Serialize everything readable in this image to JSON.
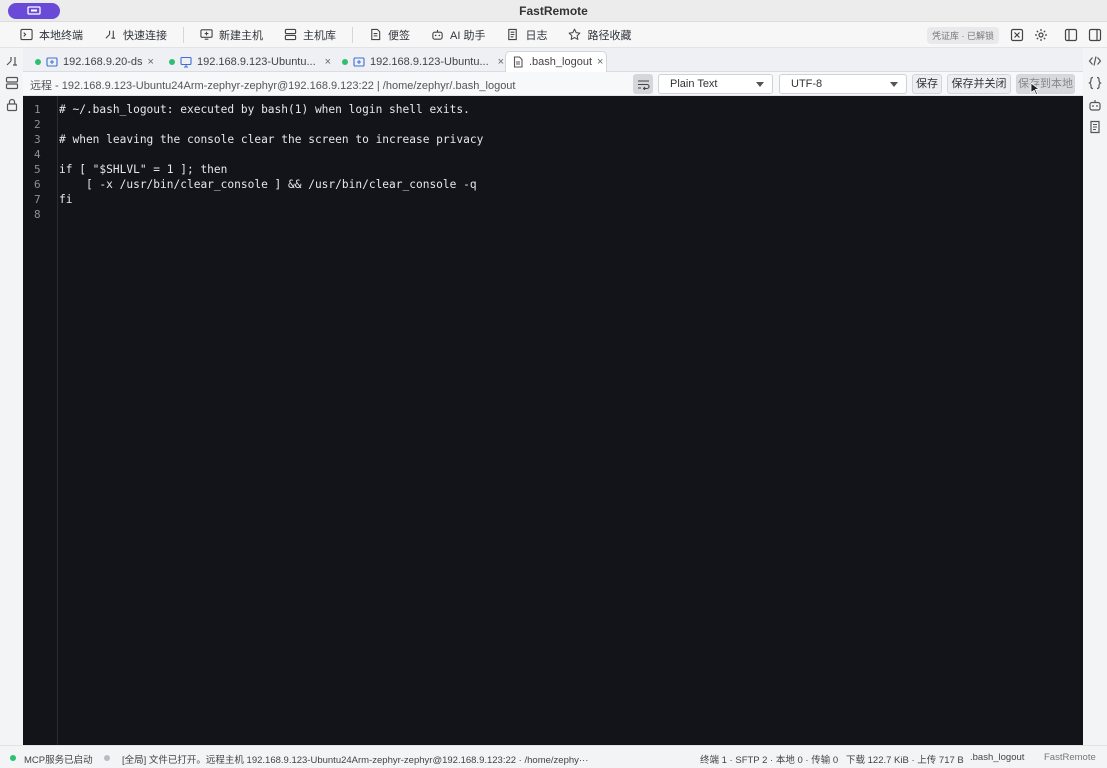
{
  "window": {
    "title": "FastRemote"
  },
  "toolbar": {
    "items": [
      {
        "label": "本地终端",
        "icon": "terminal-icon"
      },
      {
        "label": "快速连接",
        "icon": "quick-connect-icon"
      },
      {
        "label": "新建主机",
        "icon": "new-host-icon"
      },
      {
        "label": "主机库",
        "icon": "host-library-icon"
      },
      {
        "label": "便签",
        "icon": "note-icon"
      },
      {
        "label": "AI 助手",
        "icon": "ai-robot-icon"
      },
      {
        "label": "日志",
        "icon": "log-icon"
      },
      {
        "label": "路径收藏",
        "icon": "star-icon"
      }
    ],
    "vault_badge": "凭证库 · 已解锁"
  },
  "tabs": [
    {
      "label": "192.168.9.20-ds",
      "status": "connected",
      "icon": "sftp-icon"
    },
    {
      "label": "192.168.9.123-Ubuntu...",
      "status": "connected",
      "icon": "remote-desktop-icon"
    },
    {
      "label": "192.168.9.123-Ubuntu...",
      "status": "connected",
      "icon": "sftp-icon"
    },
    {
      "label": ".bash_logout",
      "status": "active",
      "icon": "file-icon"
    }
  ],
  "path_bar": {
    "path": "远程 - 192.168.9.123-Ubuntu24Arm-zephyr-zephyr@192.168.9.123:22 | /home/zephyr/.bash_logout",
    "language": "Plain Text",
    "encoding": "UTF-8",
    "save": "保存",
    "save_close": "保存并关闭",
    "save_local": "保存到本地"
  },
  "editor": {
    "lines": [
      {
        "n": "1",
        "text": "# ~/.bash_logout: executed by bash(1) when login shell exits."
      },
      {
        "n": "2",
        "text": ""
      },
      {
        "n": "3",
        "text": "# when leaving the console clear the screen to increase privacy"
      },
      {
        "n": "4",
        "text": ""
      },
      {
        "n": "5",
        "text": "if [ \"$SHLVL\" = 1 ]; then"
      },
      {
        "n": "6",
        "text": "    [ -x /usr/bin/clear_console ] && /usr/bin/clear_console -q"
      },
      {
        "n": "7",
        "text": "fi"
      },
      {
        "n": "8",
        "text": ""
      }
    ]
  },
  "status_bar": {
    "mcp": "MCP服务已启动",
    "message": "[全局] 文件已打开。远程主机 192.168.9.123-Ubuntu24Arm-zephyr-zephyr@192.168.9.123:22 · /home/zephy···",
    "counts": "终端 1 · SFTP 2 · 本地 0 · 传输 0",
    "transfer": "下载 122.7 KiB · 上传 717 B",
    "file": ".bash_logout",
    "app": "FastRemote"
  },
  "colors": {
    "accent": "#6a4bd8",
    "connected": "#2fbf71",
    "editor_bg": "#12141a"
  }
}
